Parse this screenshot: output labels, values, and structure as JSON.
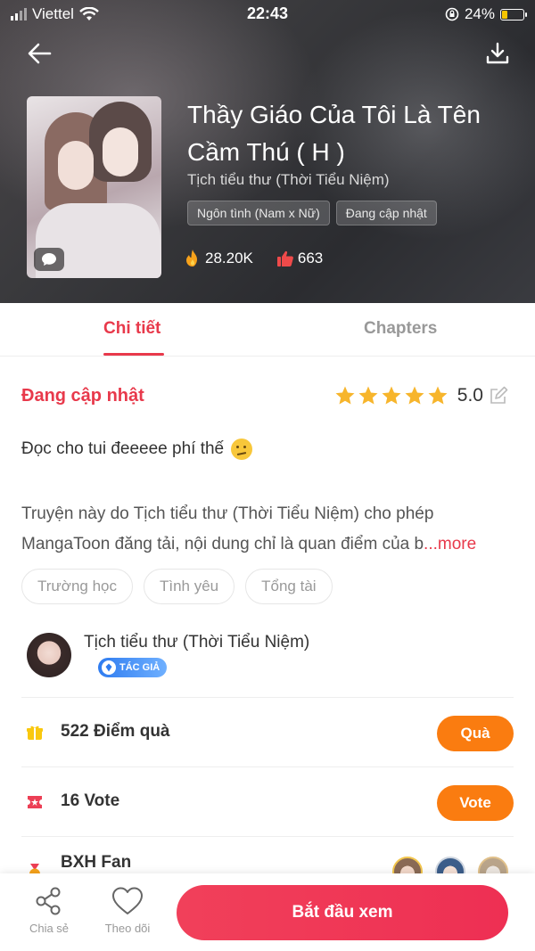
{
  "status_bar": {
    "carrier": "Viettel",
    "time": "22:43",
    "battery": "24%",
    "battery_level": 0.24
  },
  "header": {
    "title": "Thầy Giáo Của Tôi Là Tên Cầm Thú ( H )",
    "author": "Tịch tiểu thư (Thời Tiểu Niệm)",
    "tags": [
      "Ngôn tình (Nam x Nữ)",
      "Đang cập nhật"
    ],
    "views": "28.20K",
    "likes": "663",
    "icons": {
      "back": "arrow-left-icon",
      "download": "download-icon",
      "comment": "chat-bubble-icon",
      "views": "fire-icon",
      "likes": "thumbs-up-icon"
    }
  },
  "tabs": [
    {
      "label": "Chi tiết",
      "active": true
    },
    {
      "label": "Chapters",
      "active": false
    }
  ],
  "detail": {
    "status": "Đang cập nhật",
    "rating": "5.0",
    "stars": 5,
    "comment": "Đọc cho tui đeeeee phí thế",
    "description_line1": "Truyện này do Tịch tiểu thư (Thời Tiểu Niệm) cho phép",
    "description_line2": "MangaToon đăng tải, nội dung chỉ là quan điểm của b",
    "more_label": "...more",
    "genres": [
      "Trường học",
      "Tình yêu",
      "Tổng tài"
    ]
  },
  "author": {
    "name": "Tịch tiểu thư (Thời Tiểu Niệm)",
    "badge": "TÁC GIẢ"
  },
  "rows": {
    "gift": {
      "label": "522 Điểm quà",
      "button": "Quà"
    },
    "vote": {
      "label": "16 Vote",
      "button": "Vote"
    },
    "fans": {
      "label": "BXH Fan"
    }
  },
  "colors": {
    "accent": "#e8394b",
    "orange": "#fa7c10"
  },
  "bottom_bar": {
    "share": "Chia sẻ",
    "follow": "Theo dõi",
    "start": "Bắt đầu xem"
  }
}
